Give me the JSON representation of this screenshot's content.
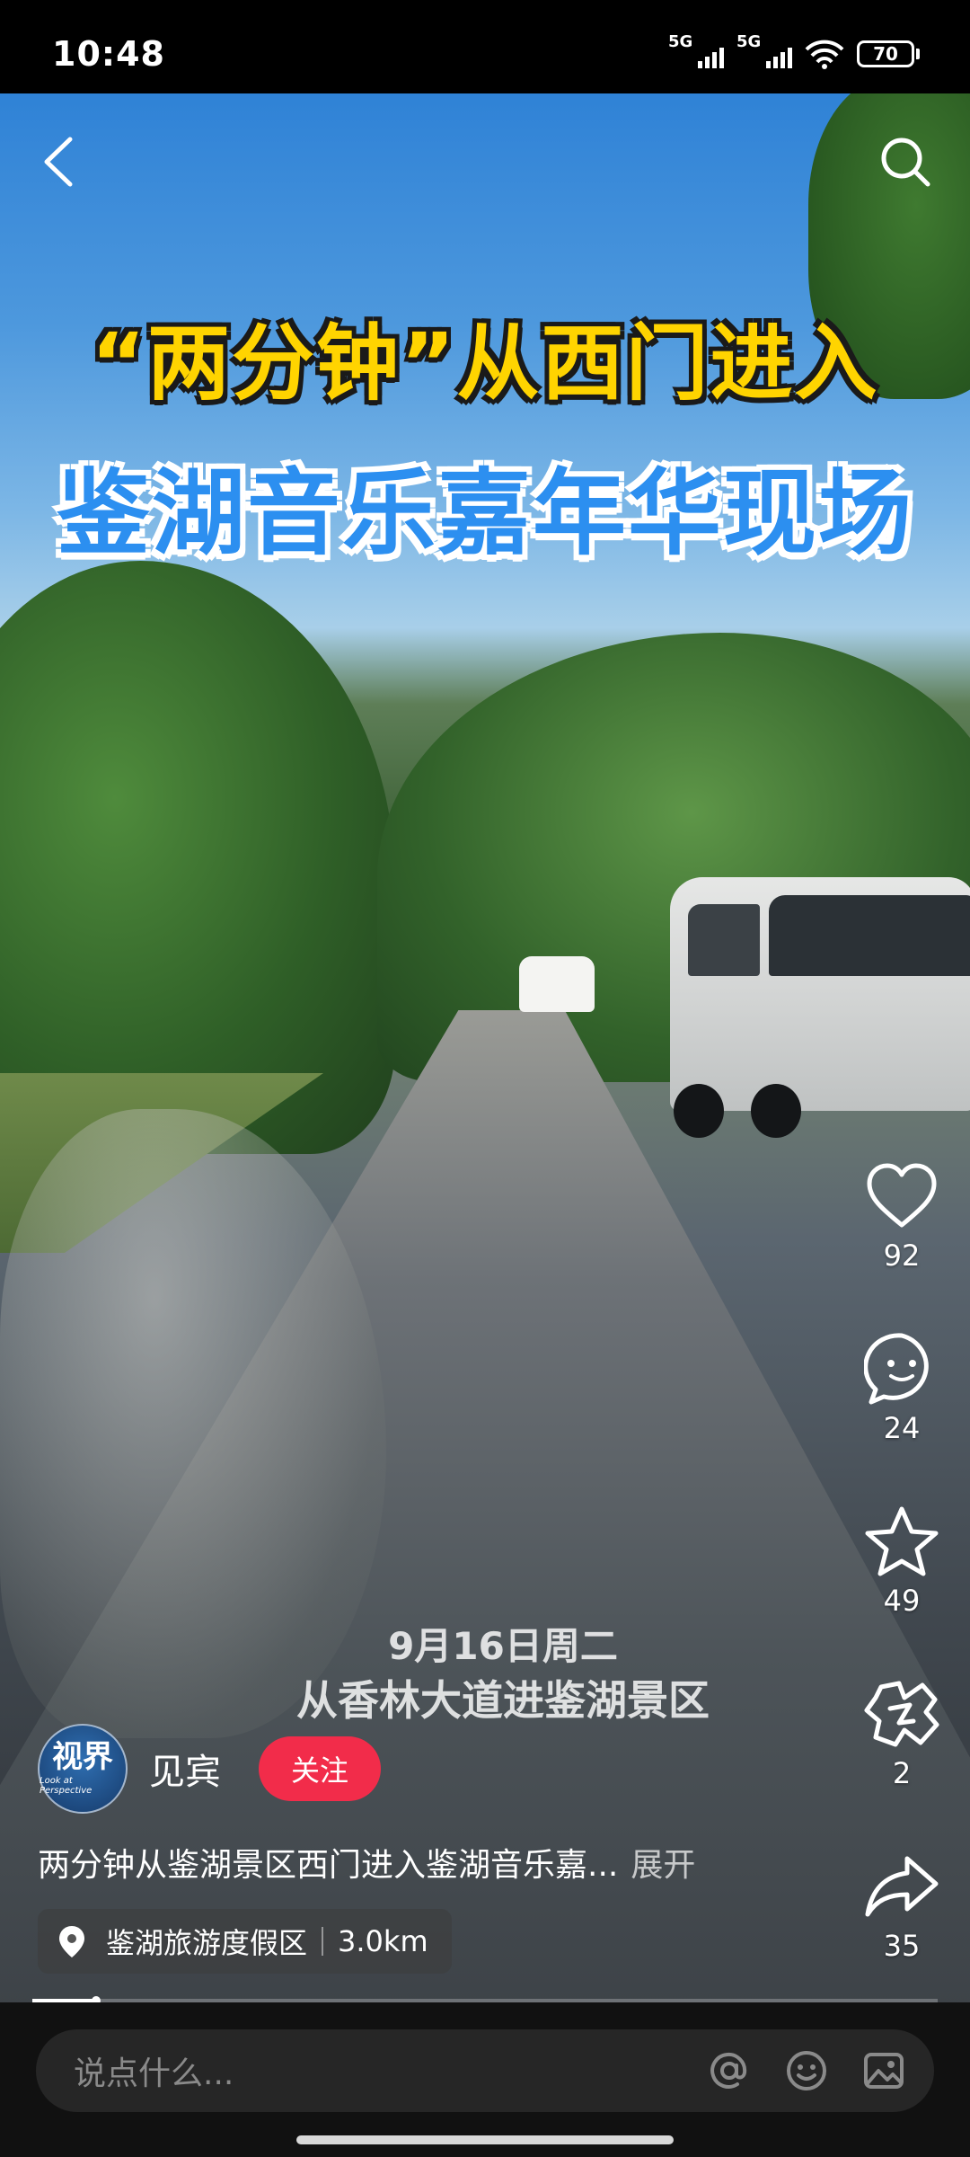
{
  "status_bar": {
    "time": "10:48",
    "signal_1": "5G",
    "signal_2": "5G",
    "battery": "70"
  },
  "video": {
    "headline_line1": "“两分钟”从西门进入",
    "headline_line2": "鉴湖音乐嘉年华现场",
    "overlay_date": "9月16日周二",
    "overlay_route": "从香林大道进鉴湖景区"
  },
  "rail": {
    "like_count": "92",
    "comment_count": "24",
    "favorite_count": "49",
    "gift_count": "2",
    "share_count": "35"
  },
  "author": {
    "avatar_text": "视界",
    "avatar_subtext": "Look at Perspective",
    "name": "见宾",
    "follow_label": "关注"
  },
  "caption": {
    "text": "两分钟从鉴湖景区西门进入鉴湖音乐嘉...",
    "expand_label": "展开"
  },
  "location": {
    "name": "鉴湖旅游度假区",
    "distance": "3.0km"
  },
  "progress": {
    "fraction": 0.07
  },
  "comment_bar": {
    "placeholder": "说点什么..."
  },
  "icons": [
    "back-icon",
    "search-icon",
    "heart-icon",
    "comment-icon",
    "star-icon",
    "gift-icon",
    "share-icon",
    "location-pin-icon",
    "mention-icon",
    "emoji-icon",
    "image-icon"
  ]
}
